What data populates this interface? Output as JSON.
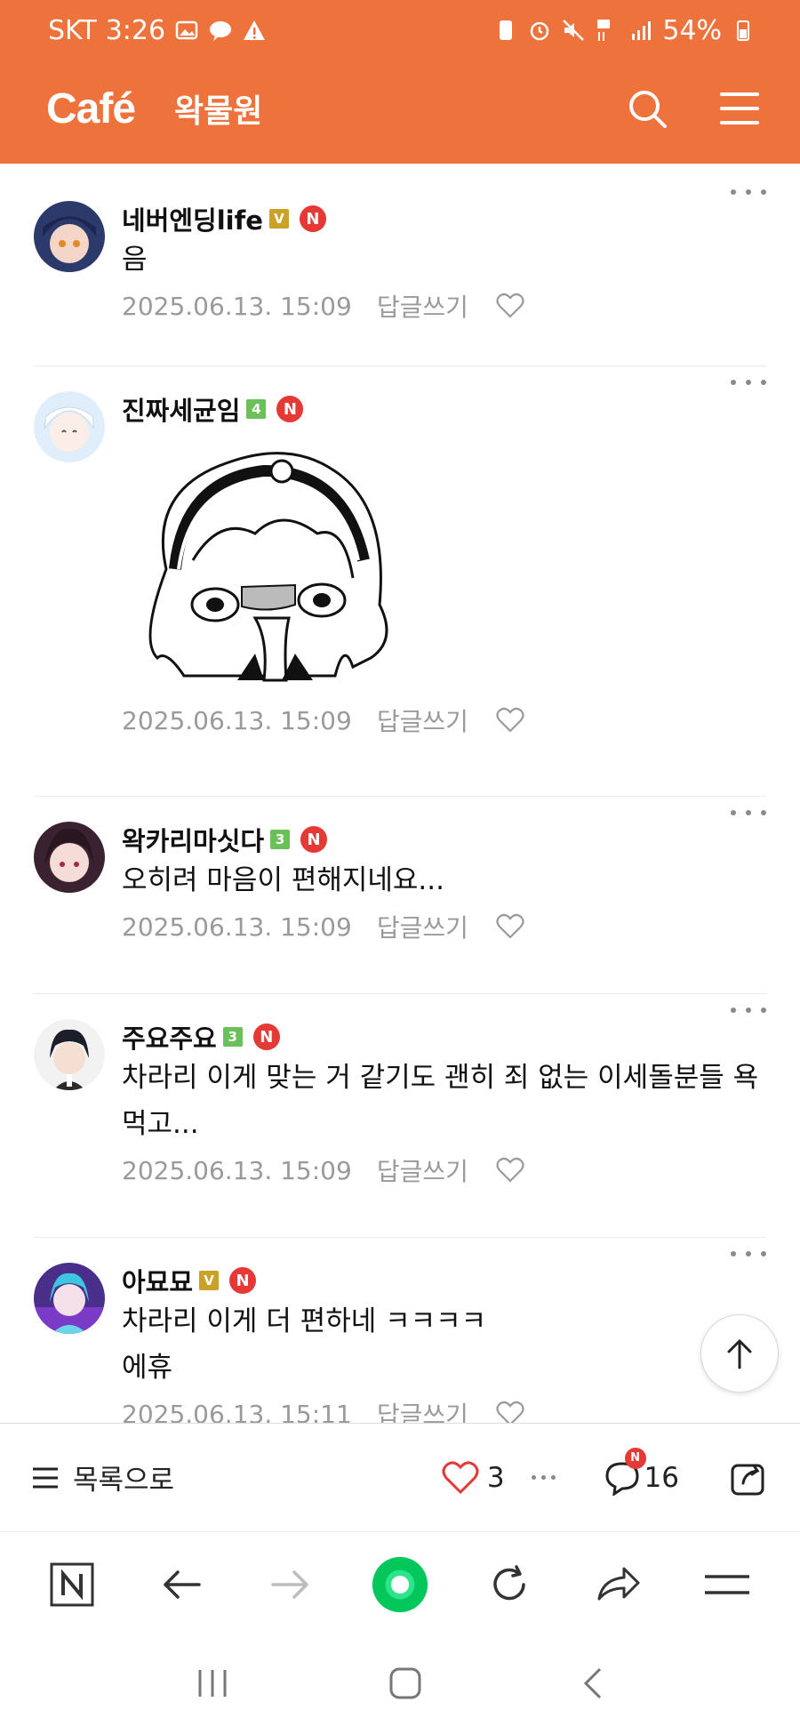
{
  "status": {
    "carrier": "SKT",
    "time": "3:26",
    "battery": "54%"
  },
  "header": {
    "logo": "Café",
    "cafe_name": "왁물원"
  },
  "comments": [
    {
      "nick": "네버엔딩life",
      "level": "V",
      "level_color": "#c9a227",
      "text": "음",
      "date": "2025.06.13. 15:09",
      "reply": "답글쓰기"
    },
    {
      "nick": "진짜세균임",
      "level": "4",
      "level_color": "#6cc05a",
      "text": "",
      "date": "2025.06.13. 15:09",
      "reply": "답글쓰기"
    },
    {
      "nick": "왁카리마싯다",
      "level": "3",
      "level_color": "#6cc05a",
      "text": "오히려 마음이 편해지네요...",
      "date": "2025.06.13. 15:09",
      "reply": "답글쓰기"
    },
    {
      "nick": "주요주요",
      "level": "3",
      "level_color": "#6cc05a",
      "text": "차라리 이게 맞는 거 같기도 괜히 죄 없는 이세돌분들 욕 먹고...",
      "date": "2025.06.13. 15:09",
      "reply": "답글쓰기"
    },
    {
      "nick": "아묘묘",
      "level": "V",
      "level_color": "#c9a227",
      "text": "차라리 이게 더 편하네 ㅋㅋㅋㅋ",
      "text2": "에휴",
      "date": "2025.06.13. 15:11",
      "reply": "답글쓰기"
    }
  ],
  "new_badge": "N",
  "actionbar": {
    "to_list": "목록으로",
    "like_count": "3",
    "comment_count": "16",
    "comment_new": "N"
  },
  "colors": {
    "brand": "#ee723b",
    "new_badge": "#e53935",
    "naver_green": "#03c75a"
  }
}
